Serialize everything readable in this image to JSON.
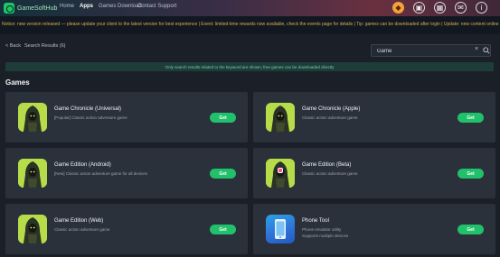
{
  "app": {
    "logo_text": "GameSoftHub"
  },
  "nav": [
    {
      "label": "Home"
    },
    {
      "label": "Apps"
    },
    {
      "label": "Games"
    },
    {
      "label": "Download"
    },
    {
      "label": "Contact Support"
    }
  ],
  "top_icons": [
    "gift-icon",
    "shop-icon",
    "store-icon",
    "mail-icon",
    "info-icon"
  ],
  "ticker": "Notice: new version released — please update your client to the latest version for best experience  |  Event: limited-time rewards now available, check the events page for details  |  Tip: games can be downloaded after login  |  Update: new content online",
  "breadcrumb": {
    "back": "< Back",
    "current": "Search Results (6)"
  },
  "search": {
    "value": "Game",
    "placeholder": ""
  },
  "notice_bar": "Only search results related to the keyword are shown; free games can be downloaded directly",
  "section": {
    "title": "Games"
  },
  "cards": [
    {
      "title": "Game Chronicle (Universal)",
      "desc": "[Popular] Classic action adventure game",
      "desc2": "",
      "button": "Get",
      "icon": "hooded-figure-icon"
    },
    {
      "title": "Game Chronicle (Apple)",
      "desc": "Classic action adventure game",
      "desc2": "",
      "button": "Get",
      "icon": "hooded-figure-icon"
    },
    {
      "title": "Game Edition (Android)",
      "desc": "[New] Classic action adventure game for all devices",
      "desc2": "",
      "button": "Get",
      "icon": "hooded-figure-icon"
    },
    {
      "title": "Game Edition (Beta)",
      "desc": "Classic action adventure game",
      "desc2": "",
      "button": "Get",
      "icon": "hooded-figure-icon"
    },
    {
      "title": "Game Edition (Web)",
      "desc": "Classic action adventure game",
      "desc2": "",
      "button": "Get",
      "icon": "hooded-figure-icon"
    },
    {
      "title": "Phone Tool",
      "desc": "Phone emulator utility",
      "desc2": "Supports multiple devices",
      "button": "Get",
      "icon": "phone-app-icon"
    }
  ],
  "colors": {
    "accent": "#21c16c",
    "background": "#1b2028",
    "card": "#2a313b",
    "ticker_text": "#d8b04a"
  }
}
